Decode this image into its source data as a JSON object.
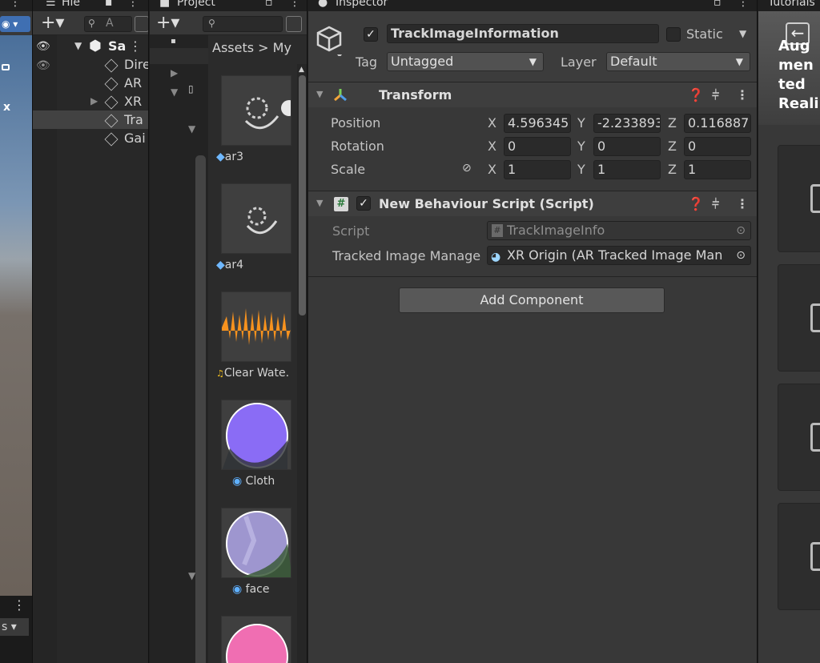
{
  "hierarchy": {
    "tab": "Hie",
    "search_placeholder": "A",
    "scene_root": "Sa",
    "items": [
      "Dire",
      "AR",
      "XR",
      "Tra",
      "Gai"
    ]
  },
  "project": {
    "tab": "Project",
    "breadcrumb": "Assets > My",
    "assets": [
      {
        "name": "ar3",
        "kind": "prefab"
      },
      {
        "name": "ar4",
        "kind": "prefab"
      },
      {
        "name": "Clear Wate.",
        "kind": "audio"
      },
      {
        "name": "Cloth",
        "kind": "material"
      },
      {
        "name": "face",
        "kind": "material"
      }
    ]
  },
  "inspector": {
    "tab": "Inspector",
    "object_name": "TrackImageInformation",
    "static_label": "Static",
    "tag_label": "Tag",
    "tag_value": "Untagged",
    "layer_label": "Layer",
    "layer_value": "Default",
    "transform": {
      "title": "Transform",
      "position_label": "Position",
      "rotation_label": "Rotation",
      "scale_label": "Scale",
      "x_label": "X",
      "y_label": "Y",
      "z_label": "Z",
      "position": {
        "x": "4.596345",
        "y": "-2.233893",
        "z": "0.116887"
      },
      "rotation": {
        "x": "0",
        "y": "0",
        "z": "0"
      },
      "scale": {
        "x": "1",
        "y": "1",
        "z": "1"
      }
    },
    "script_component": {
      "title": "New Behaviour Script (Script)",
      "script_label": "Script",
      "script_value": "TrackImageInfo",
      "tracked_label": "Tracked Image Manage",
      "tracked_value": "XR Origin (AR Tracked Image Man"
    },
    "add_component": "Add Component"
  },
  "tutorials": {
    "tab": "Tutorials",
    "title": "Augmented Reality Temp"
  },
  "colors": {
    "accent_orange": "#f7921e",
    "material_purple": "#8a6cf5",
    "material_pink": "#f06eb2",
    "panel_bg": "#383838"
  }
}
